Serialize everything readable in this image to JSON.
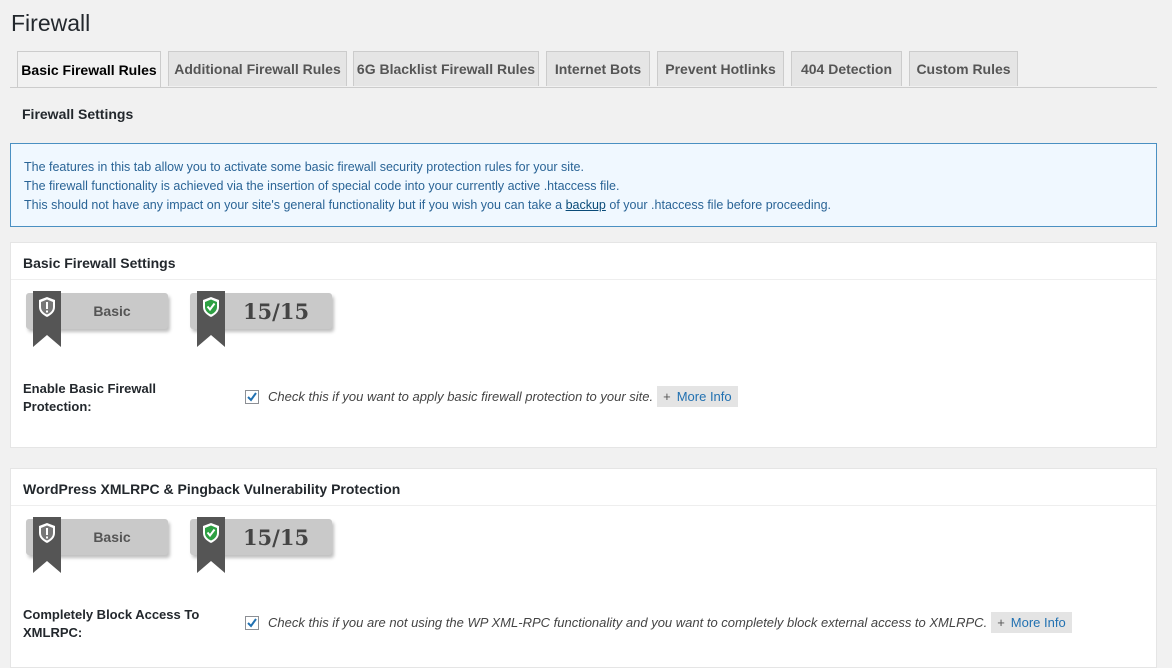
{
  "page": {
    "title": "Firewall"
  },
  "tabs": [
    {
      "label": "Basic Firewall Rules"
    },
    {
      "label": "Additional Firewall Rules"
    },
    {
      "label": "6G Blacklist Firewall Rules"
    },
    {
      "label": "Internet Bots"
    },
    {
      "label": "Prevent Hotlinks"
    },
    {
      "label": "404 Detection"
    },
    {
      "label": "Custom Rules"
    }
  ],
  "section": {
    "subtitle": "Firewall Settings"
  },
  "notice": {
    "line1": "The features in this tab allow you to activate some basic firewall security protection rules for your site.",
    "line2": "The firewall functionality is achieved via the insertion of special code into your currently active .htaccess file.",
    "line3_before": "This should not have any impact on your site's general functionality but if you wish you can take a ",
    "line3_link": "backup",
    "line3_after": " of your .htaccess file before proceeding."
  },
  "boxes": [
    {
      "title": "Basic Firewall Settings",
      "level_badge": "Basic",
      "score_badge": "15/15",
      "option_label": "Enable Basic Firewall Protection:",
      "checked": true,
      "option_desc": "Check this if you want to apply basic firewall protection to your site.",
      "more_info": "More Info"
    },
    {
      "title": "WordPress XMLRPC & Pingback Vulnerability Protection",
      "level_badge": "Basic",
      "score_badge": "15/15",
      "option_label": "Completely Block Access To XMLRPC:",
      "checked": true,
      "option_desc": "Check this if you are not using the WP XML-RPC functionality and you want to completely block external access to XMLRPC.",
      "more_info": "More Info"
    }
  ],
  "colors": {
    "shield_basic": "#777777",
    "shield_score": "#2ea043",
    "ribbon": "#555555",
    "link": "#2271b1"
  }
}
